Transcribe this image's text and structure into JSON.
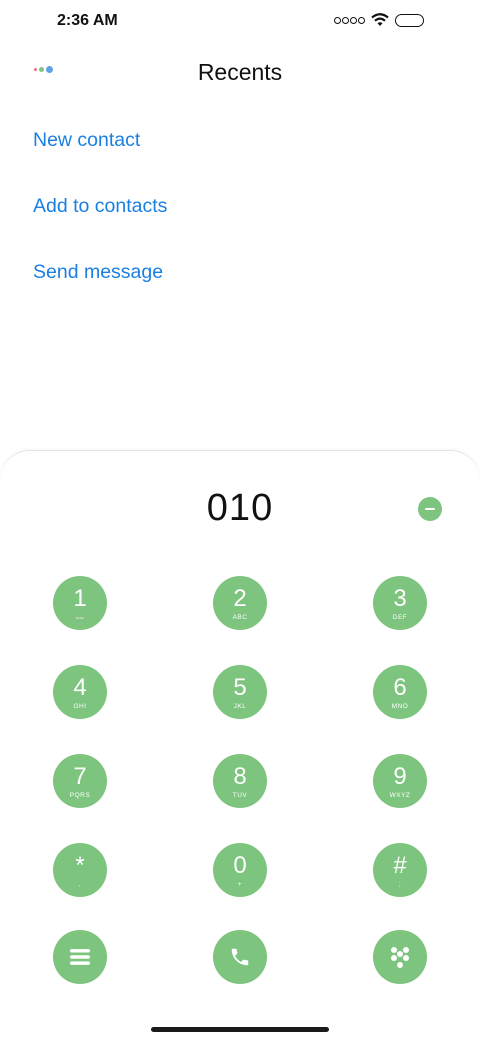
{
  "status_bar": {
    "time": "2:36 AM"
  },
  "header": {
    "title": "Recents",
    "menu_dot_colors": [
      "#e57373",
      "#7dc47e",
      "#64a0e8"
    ]
  },
  "actions": [
    {
      "label": "New contact"
    },
    {
      "label": "Add to contacts"
    },
    {
      "label": "Send message"
    }
  ],
  "dialer": {
    "number": "010",
    "keys": [
      {
        "digit": "1",
        "letters": "ᴗᴗ"
      },
      {
        "digit": "2",
        "letters": "ABC"
      },
      {
        "digit": "3",
        "letters": "DEF"
      },
      {
        "digit": "4",
        "letters": "GHI"
      },
      {
        "digit": "5",
        "letters": "JKL"
      },
      {
        "digit": "6",
        "letters": "MNO"
      },
      {
        "digit": "7",
        "letters": "PQRS"
      },
      {
        "digit": "8",
        "letters": "TUV"
      },
      {
        "digit": "9",
        "letters": "WXYZ"
      },
      {
        "digit": "*",
        "letters": ","
      },
      {
        "digit": "0",
        "letters": "+"
      },
      {
        "digit": "#",
        "letters": ";"
      }
    ]
  },
  "colors": {
    "accent_link": "#1a7fe3",
    "dial_green": "#7dc47e"
  },
  "icons": {
    "backspace": "minus-circle-icon",
    "menu": "hamburger-menu-icon",
    "call": "phone-icon",
    "keypad_toggle": "keypad-dots-icon"
  }
}
